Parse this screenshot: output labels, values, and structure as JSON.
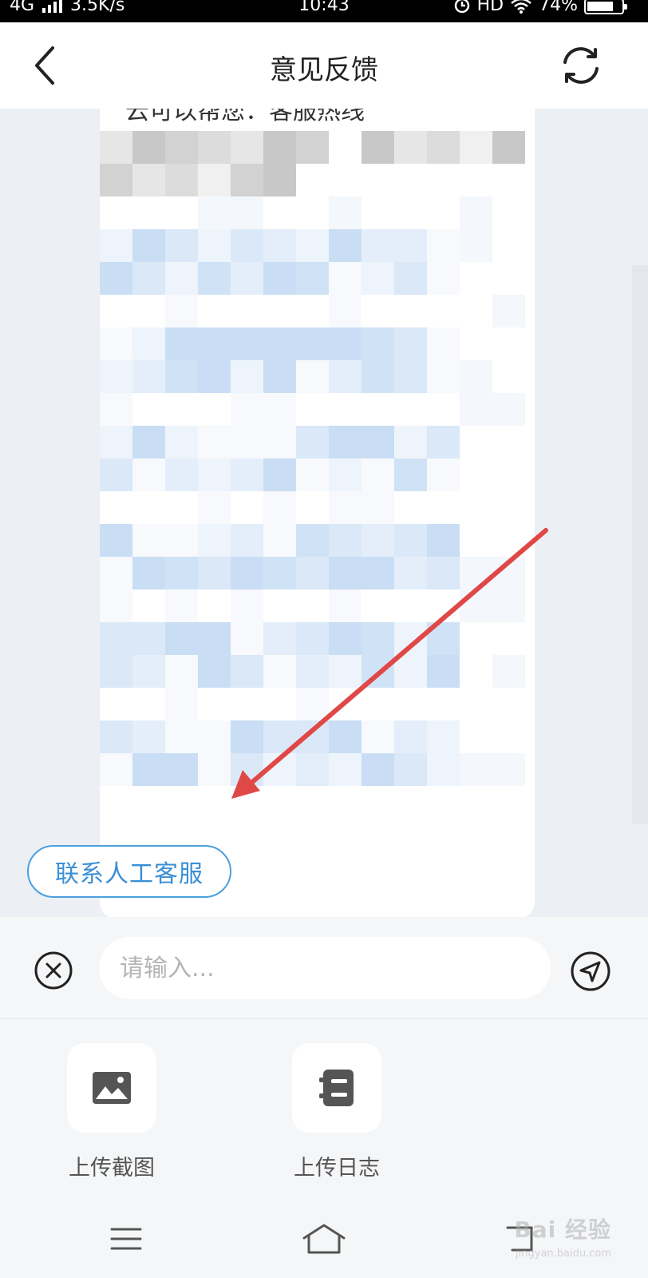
{
  "status_bar": {
    "network": "4G",
    "speed": "3.5K/s",
    "time": "10:43",
    "hd": "HD",
    "battery": "74%",
    "battery_level": 0.74
  },
  "header": {
    "title": "意见反馈",
    "back_icon": "chevron-left-icon",
    "refresh_icon": "refresh-icon"
  },
  "chat": {
    "bubble_first_line": "云可以帮您：客服热线",
    "human_service_label": "联系人工客服"
  },
  "input_bar": {
    "placeholder": "请输入...",
    "cancel_icon": "close-circle-icon",
    "send_icon": "send-icon"
  },
  "tools": [
    {
      "label": "上传截图",
      "icon": "image-icon"
    },
    {
      "label": "上传日志",
      "icon": "log-icon"
    }
  ],
  "system_nav": {
    "menu_icon": "menu-icon",
    "home_icon": "home-icon",
    "back_icon": "back-icon"
  },
  "watermark": {
    "brand": "Bai 经验",
    "url": "jingyan.baidu.com"
  },
  "colors": {
    "accent": "#3a8fd6",
    "chat_background": "#ecf0f4",
    "annotation_arrow": "#e04848"
  }
}
